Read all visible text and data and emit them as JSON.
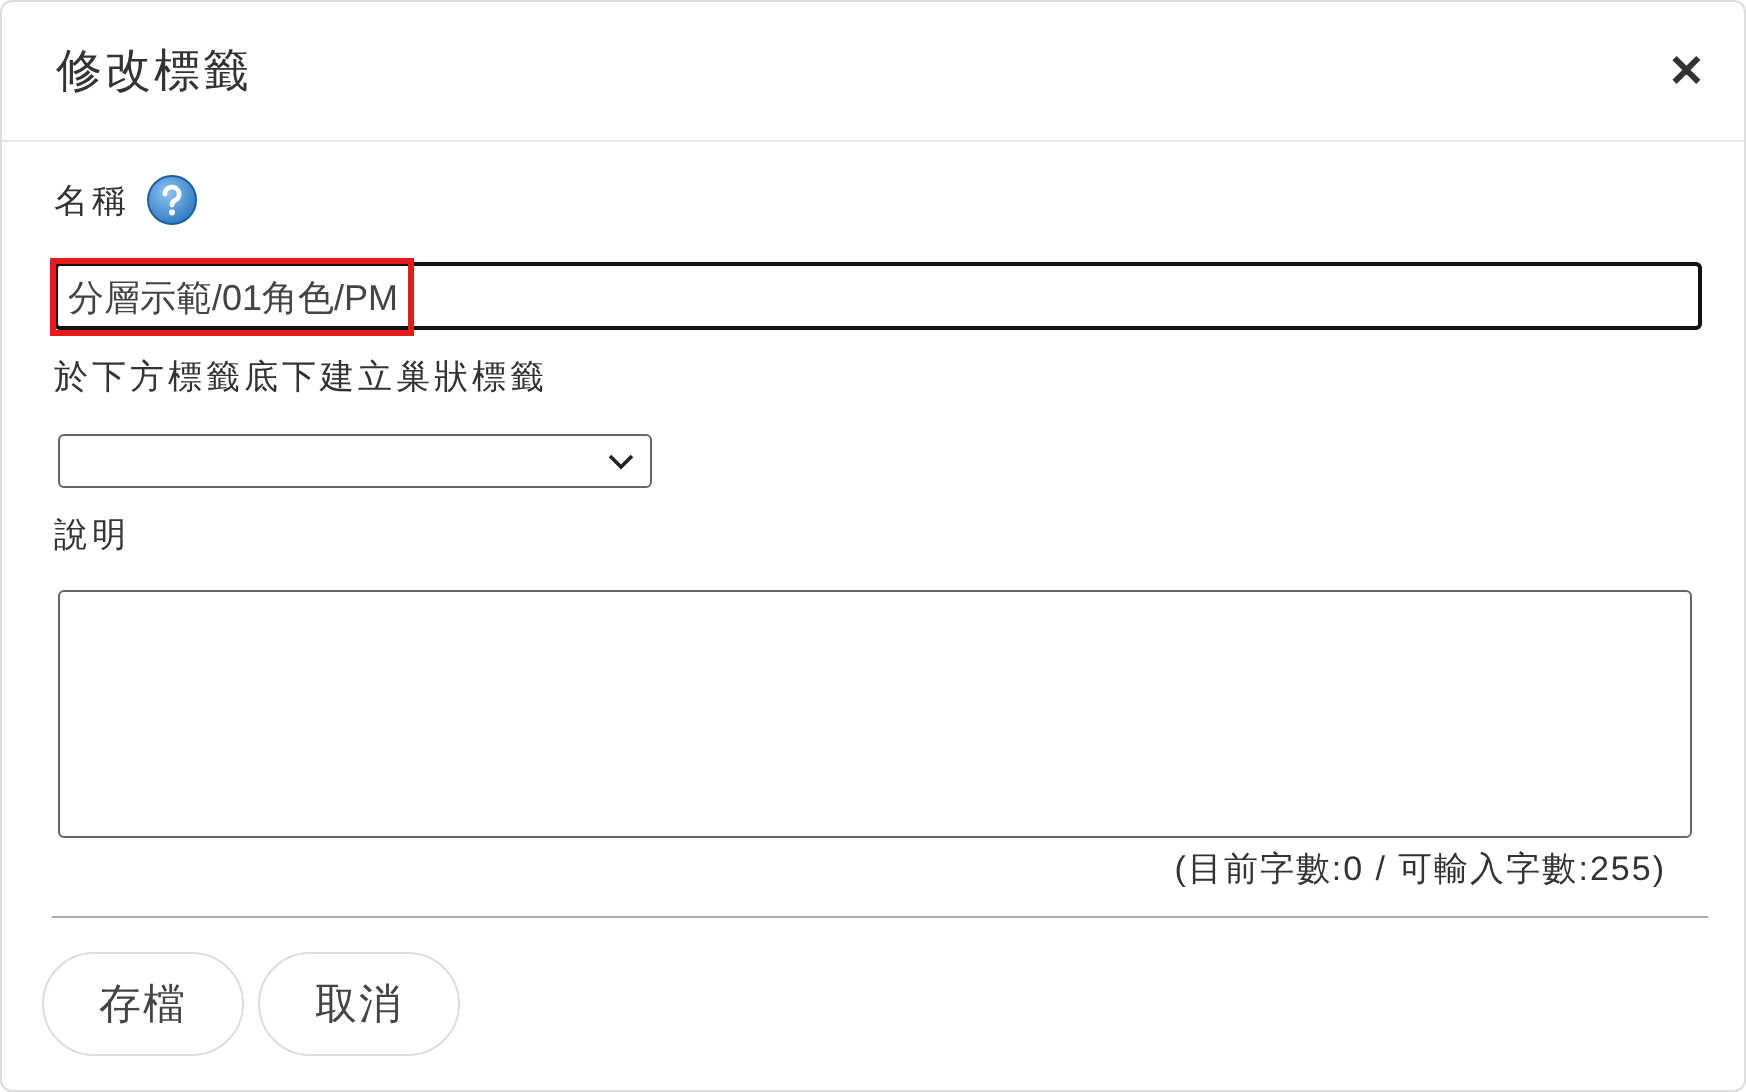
{
  "dialog": {
    "title": "修改標籤",
    "close": "✕"
  },
  "name_field": {
    "label": "名稱",
    "value": "分層示範/01角色/PM",
    "highlighted": true
  },
  "parent_select": {
    "label": "於下方標籤底下建立巢狀標籤"
  },
  "description": {
    "label": "說明",
    "counter": "(目前字數:0 / 可輸入字數:255)"
  },
  "buttons": [
    "存檔",
    "取消"
  ]
}
